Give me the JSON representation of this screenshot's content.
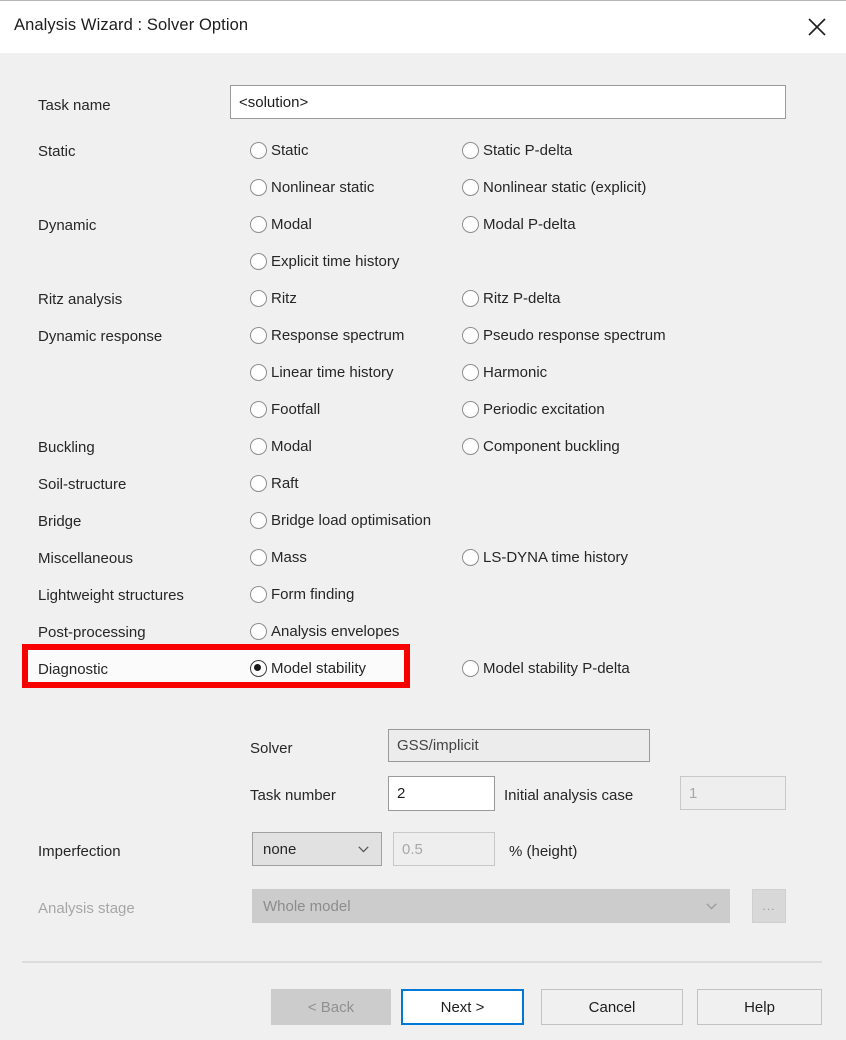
{
  "window": {
    "title": "Analysis Wizard : Solver Option",
    "close_icon": "close-icon"
  },
  "task_name": {
    "label": "Task name",
    "value": "<solution>"
  },
  "groups": [
    {
      "label": "Static",
      "rows": [
        {
          "col1": "Static",
          "col2": "Static P-delta"
        },
        {
          "col1": "Nonlinear static",
          "col2": "Nonlinear static (explicit)"
        }
      ]
    },
    {
      "label": "Dynamic",
      "rows": [
        {
          "col1": "Modal",
          "col2": "Modal P-delta"
        },
        {
          "col1": "Explicit time history",
          "col2": ""
        }
      ]
    },
    {
      "label": "Ritz analysis",
      "rows": [
        {
          "col1": "Ritz",
          "col2": "Ritz P-delta"
        }
      ]
    },
    {
      "label": "Dynamic response",
      "rows": [
        {
          "col1": "Response spectrum",
          "col2": "Pseudo response spectrum"
        },
        {
          "col1": "Linear time history",
          "col2": "Harmonic"
        },
        {
          "col1": "Footfall",
          "col2": "Periodic excitation"
        }
      ]
    },
    {
      "label": "Buckling",
      "rows": [
        {
          "col1": "Modal",
          "col2": "Component buckling"
        }
      ]
    },
    {
      "label": "Soil-structure",
      "rows": [
        {
          "col1": "Raft",
          "col2": ""
        }
      ]
    },
    {
      "label": "Bridge",
      "rows": [
        {
          "col1": "Bridge load optimisation",
          "col2": ""
        }
      ]
    },
    {
      "label": "Miscellaneous",
      "rows": [
        {
          "col1": "Mass",
          "col2": "LS-DYNA time history"
        }
      ]
    },
    {
      "label": "Lightweight structures",
      "rows": [
        {
          "col1": "Form finding",
          "col2": ""
        }
      ]
    },
    {
      "label": "Post-processing",
      "rows": [
        {
          "col1": "Analysis envelopes",
          "col2": ""
        }
      ]
    },
    {
      "label": "Diagnostic",
      "rows": [
        {
          "col1": "Model stability",
          "col2": "Model stability P-delta"
        }
      ]
    }
  ],
  "selected_option": "Model stability",
  "highlight_color": "#f90000",
  "solver": {
    "label": "Solver",
    "value": "GSS/implicit"
  },
  "task_number": {
    "label": "Task number",
    "value": "2"
  },
  "initial_analysis_case": {
    "label": "Initial analysis case",
    "value": "1"
  },
  "imperfection": {
    "label": "Imperfection",
    "selected": "none",
    "amount": "0.5",
    "units": "% (height)"
  },
  "analysis_stage": {
    "label": "Analysis stage",
    "selected": "Whole model",
    "browse_label": "..."
  },
  "footer": {
    "back": "< Back",
    "next": "Next >",
    "cancel": "Cancel",
    "help": "Help"
  }
}
